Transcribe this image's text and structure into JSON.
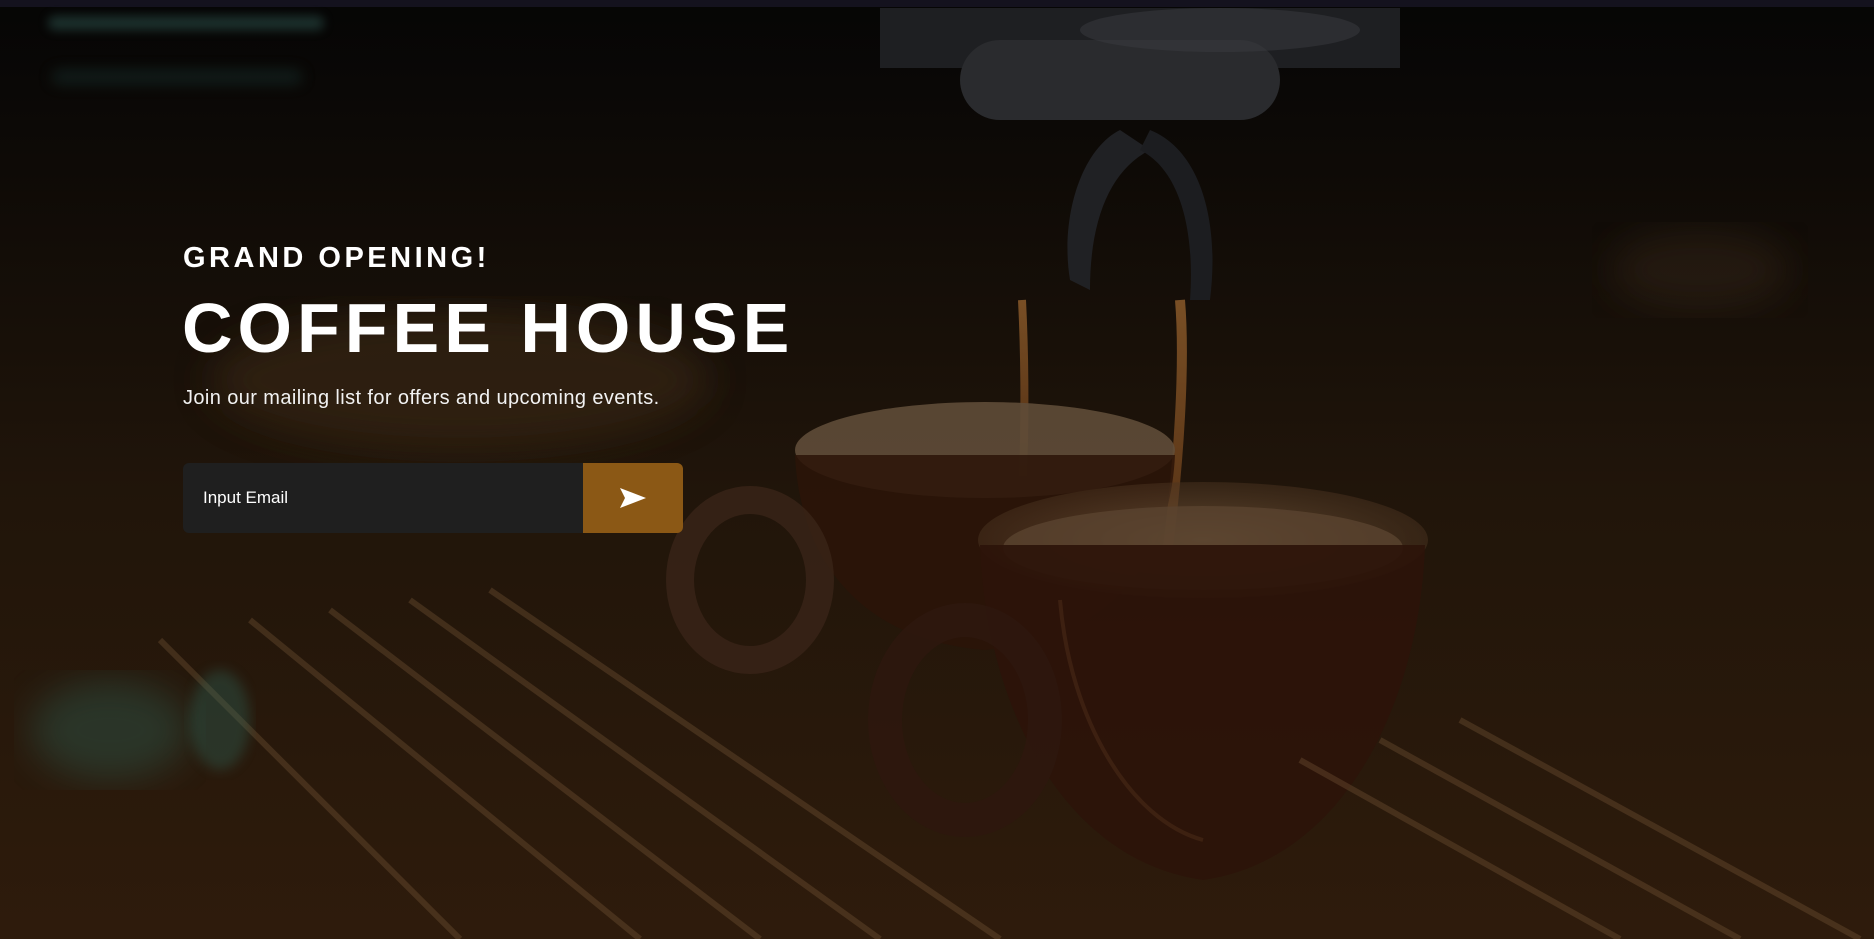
{
  "hero": {
    "eyebrow": "GRAND OPENING!",
    "title": "COFFEE HOUSE",
    "subtitle": "Join our mailing list for offers and upcoming events."
  },
  "form": {
    "email_placeholder": "Input Email",
    "email_value": "",
    "submit_icon": "send-arrow-icon"
  },
  "colors": {
    "accent": "#8b5815",
    "input_bg": "#1f1f1f",
    "text": "#ffffff",
    "overlay_top": "#050505",
    "overlay_bottom": "#341e0c"
  },
  "background": {
    "image_subject": "espresso pouring into cups on coffee machine"
  }
}
